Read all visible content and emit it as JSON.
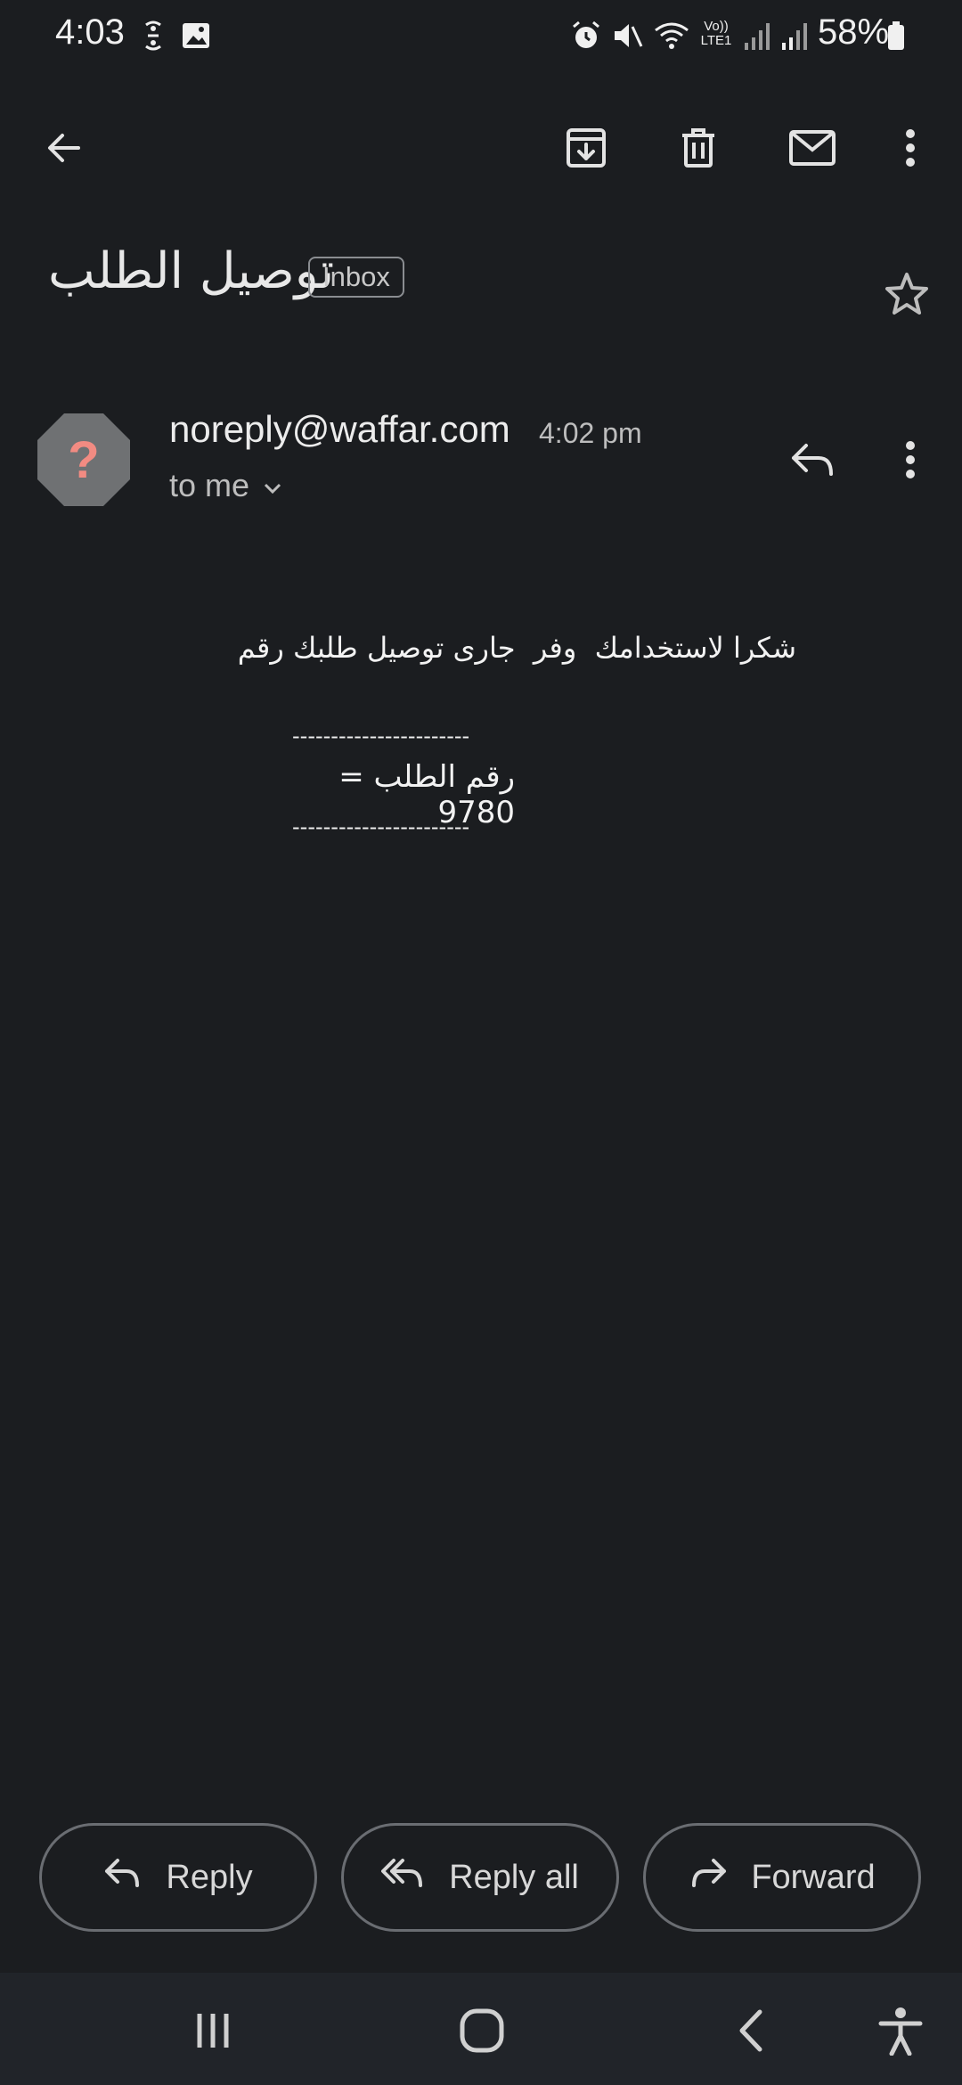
{
  "status_bar": {
    "time": "4:03",
    "battery_percent": "58%",
    "network_label": "Vo)) LTE1",
    "icons": [
      "sim-icon",
      "gallery-icon",
      "alarm-icon",
      "mute-icon",
      "wifi-icon",
      "signal-icon",
      "battery-icon"
    ]
  },
  "toolbar": {
    "icons": [
      "back-arrow-icon",
      "archive-icon",
      "delete-icon",
      "mark-unread-icon",
      "more-vert-icon"
    ]
  },
  "email": {
    "subject": "توصيل الطلب",
    "label": "Inbox",
    "sender": "noreply@waffar.com",
    "time": "4:02 pm",
    "recipient": "to me",
    "body": {
      "line1": "شكرا لاستخدامك  وفر  جارى توصيل طلبك رقم",
      "divider": "-----------------------",
      "order_line": "رقم الطلب = 9780"
    }
  },
  "actions": {
    "reply": "Reply",
    "reply_all": "Reply all",
    "forward": "Forward"
  },
  "colors": {
    "background": "#1b1d20",
    "avatar_bg": "#6f7173",
    "avatar_mark": "#f28b82",
    "nav_bar": "#212429"
  }
}
